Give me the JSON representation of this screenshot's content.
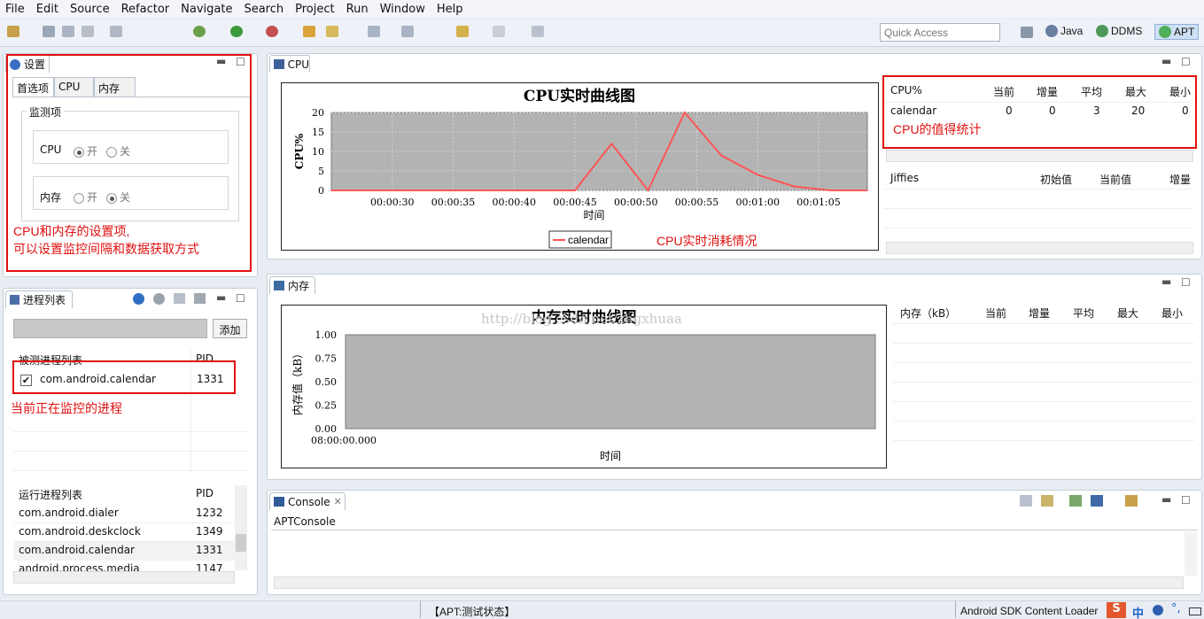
{
  "menu": [
    "File",
    "Edit",
    "Source",
    "Refactor",
    "Navigate",
    "Search",
    "Project",
    "Run",
    "Window",
    "Help"
  ],
  "quick_access": {
    "placeholder": "Quick Access"
  },
  "perspectives": [
    {
      "label": "Java"
    },
    {
      "label": "DDMS"
    },
    {
      "label": "APT"
    }
  ],
  "settings": {
    "tab_title": "设置",
    "tabs": [
      "首选项",
      "CPU",
      "内存"
    ],
    "group_title": "监测项",
    "cpu_label": "CPU",
    "mem_label": "内存",
    "on": "开",
    "off": "关",
    "cpu_selected": "on",
    "mem_selected": "off",
    "annotation_line1": "CPU和内存的设置项,",
    "annotation_line2": "可以设置监控间隔和数据获取方式"
  },
  "process": {
    "tab_title": "进程列表",
    "add_button": "添加",
    "monitored_header": "被测进程列表",
    "pid_header": "PID",
    "monitored": [
      {
        "name": "com.android.calendar",
        "pid": "1331",
        "checked": true
      }
    ],
    "annotation": "当前正在监控的进程",
    "running_header": "运行进程列表",
    "running": [
      {
        "name": "com.android.dialer",
        "pid": "1232"
      },
      {
        "name": "com.android.deskclock",
        "pid": "1349"
      },
      {
        "name": "com.android.calendar",
        "pid": "1331"
      },
      {
        "name": "android.process.media",
        "pid": "1147"
      }
    ]
  },
  "cpu_view": {
    "tab_title": "CPU",
    "annotation": "CPU实时消耗情况",
    "stats_annotation": "CPU的值得统计",
    "stats_headers": [
      "CPU%",
      "当前",
      "增量",
      "平均",
      "最大",
      "最小"
    ],
    "stats_rows": [
      [
        "calendar",
        "0",
        "0",
        "3",
        "20",
        "0"
      ]
    ],
    "jiffies_headers": [
      "Jiffies",
      "初始值",
      "当前值",
      "增量"
    ]
  },
  "mem_view": {
    "tab_title": "内存",
    "watermark": "http://blog.csdn.net/zhgxhuaa",
    "stats_headers": [
      "内存（kB）",
      "当前",
      "增量",
      "平均",
      "最大",
      "最小"
    ]
  },
  "console": {
    "tab_title": "Console",
    "label": "APTConsole"
  },
  "status": {
    "left": "【APT:测试状态】",
    "right": "Android SDK Content Loader",
    "ime": "中"
  },
  "chart_data": [
    {
      "type": "line",
      "title": "CPU实时曲线图",
      "xlabel": "时间",
      "ylabel": "CPU%",
      "ylim": [
        0,
        20
      ],
      "yticks": [
        "0",
        "5",
        "10",
        "15",
        "20"
      ],
      "xticks": [
        "00:00:30",
        "00:00:35",
        "00:00:40",
        "00:00:45",
        "00:00:50",
        "00:00:55",
        "00:01:00",
        "00:01:05"
      ],
      "grid": true,
      "legend": "bottom-center",
      "series": [
        {
          "name": "calendar",
          "color": "#ff5555",
          "x": [
            "00:00:25",
            "00:00:45",
            "00:00:48",
            "00:00:51",
            "00:00:54",
            "00:00:57",
            "00:01:00",
            "00:01:03",
            "00:01:06",
            "00:01:09"
          ],
          "values": [
            0,
            0,
            12,
            0,
            20,
            9,
            4,
            1,
            0,
            0
          ]
        }
      ]
    },
    {
      "type": "line",
      "title": "内存实时曲线图",
      "xlabel": "时间",
      "ylabel": "内存值（kB）",
      "ylim": [
        0,
        1
      ],
      "yticks": [
        "0.00",
        "0.25",
        "0.50",
        "0.75",
        "1.00"
      ],
      "xticks": [
        "08:00:00.000"
      ],
      "grid": true,
      "series": []
    }
  ]
}
